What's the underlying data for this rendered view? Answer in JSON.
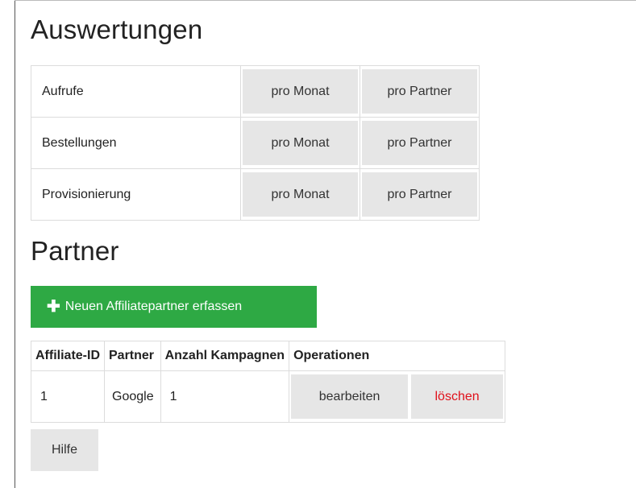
{
  "sections": {
    "auswertungen_title": "Auswertungen",
    "partner_title": "Partner"
  },
  "stats": {
    "rows": [
      {
        "label": "Aufrufe",
        "per_month": "pro Monat",
        "per_partner": "pro Partner"
      },
      {
        "label": "Bestellungen",
        "per_month": "pro Monat",
        "per_partner": "pro Partner"
      },
      {
        "label": "Provisionierung",
        "per_month": "pro Monat",
        "per_partner": "pro Partner"
      }
    ]
  },
  "partner": {
    "add_button": {
      "icon": "plus-icon",
      "label": "Neuen Affiliatepartner erfassen",
      "color": "#2ea944"
    },
    "columns": [
      "Affiliate-ID",
      "Partner",
      "Anzahl Kampagnen",
      "Operationen"
    ],
    "rows": [
      {
        "id": "1",
        "name": "Google",
        "campaigns": "1",
        "edit": "bearbeiten",
        "delete": "löschen"
      }
    ]
  },
  "help_button": "Hilfe",
  "colors": {
    "accent_green": "#2ea944",
    "delete_red": "#e0101a",
    "button_grey": "#e6e6e6"
  }
}
